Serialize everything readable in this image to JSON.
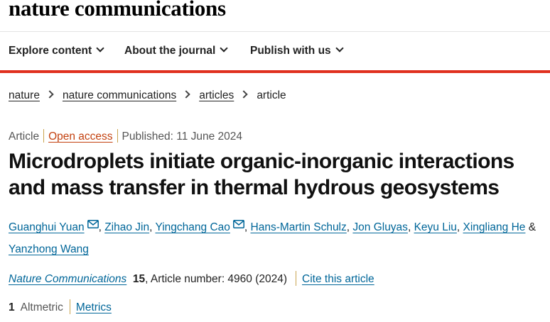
{
  "site": {
    "logo_text": "nature communications"
  },
  "nav": [
    {
      "label": "Explore content"
    },
    {
      "label": "About the journal"
    },
    {
      "label": "Publish with us"
    }
  ],
  "breadcrumb": [
    {
      "label": "nature",
      "link": true
    },
    {
      "label": "nature communications",
      "link": true
    },
    {
      "label": "articles",
      "link": true
    },
    {
      "label": "article",
      "link": false
    }
  ],
  "meta": {
    "type": "Article",
    "access": "Open access",
    "published": "Published: 11 June 2024"
  },
  "title": "Microdroplets initiate organic-inorganic interactions and mass transfer in thermal hydrous geosystems",
  "authors": [
    {
      "name": "Guanghui Yuan",
      "email": true
    },
    {
      "name": "Zihao Jin",
      "email": false
    },
    {
      "name": "Yingchang Cao",
      "email": true
    },
    {
      "name": "Hans-Martin Schulz",
      "email": false
    },
    {
      "name": "Jon Gluyas",
      "email": false
    },
    {
      "name": "Keyu Liu",
      "email": false
    },
    {
      "name": "Xingliang He",
      "email": false
    },
    {
      "name": "Yanzhong Wang",
      "email": false
    }
  ],
  "author_separator": ",",
  "author_and": "&",
  "citation": {
    "journal": "Nature Communications",
    "volume": "15",
    "article_number": ", Article number: 4960 (2024)",
    "cite_label": "Cite this article"
  },
  "metrics": {
    "altmetric_count": "1",
    "altmetric_label": "Altmetric",
    "metrics_label": "Metrics"
  },
  "colors": {
    "accent_red": "#e0301e",
    "link_blue": "#006699",
    "open_access": "#c3410f",
    "separator_gold": "#c9a34e"
  },
  "icons": {
    "nav_dropdown": "chevron-down-icon",
    "breadcrumb_sep": "chevron-right-icon",
    "author_email": "mail-icon"
  }
}
